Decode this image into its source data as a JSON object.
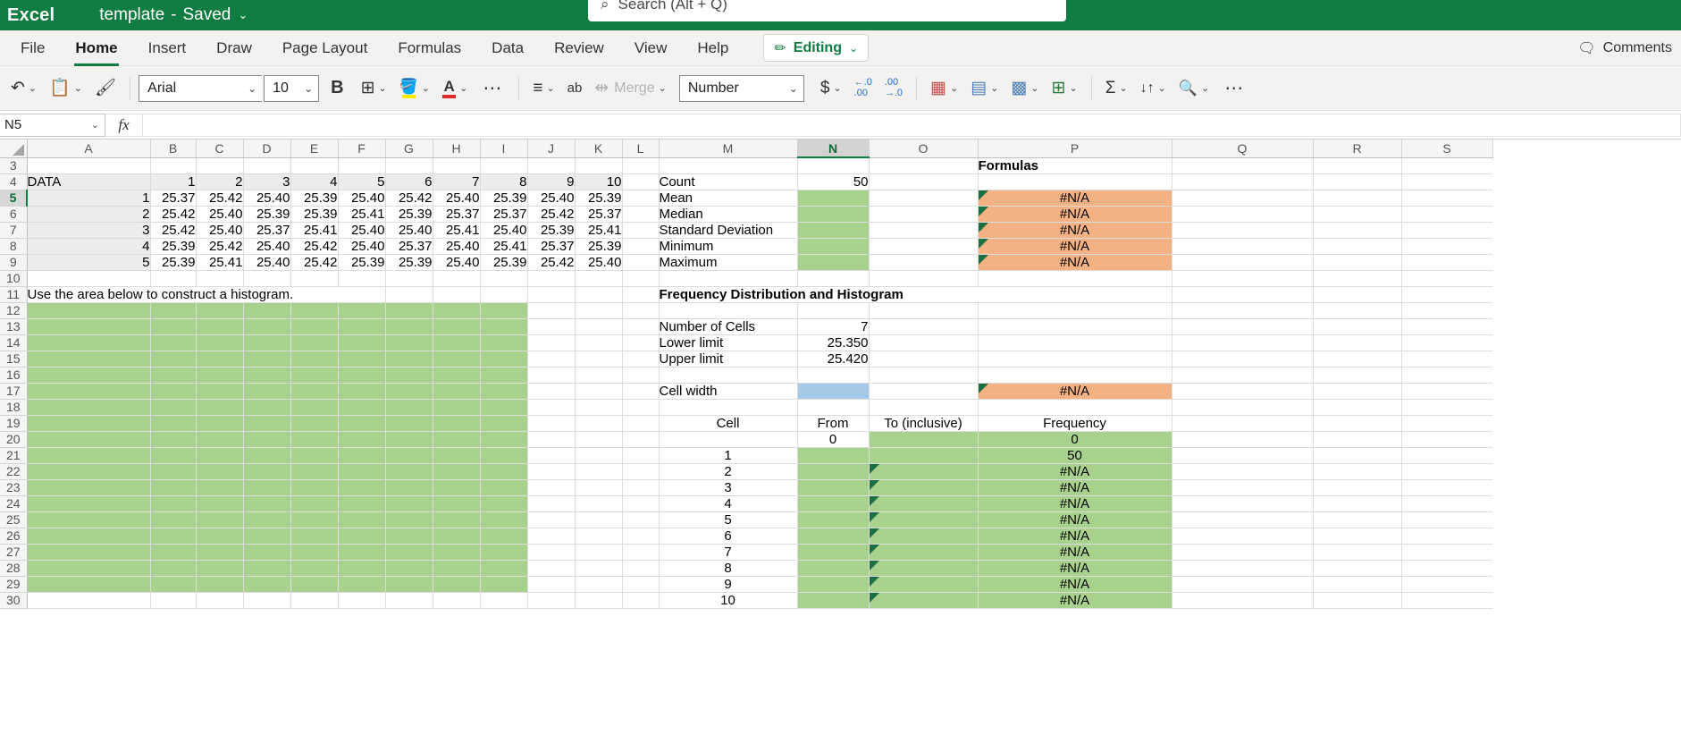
{
  "titlebar": {
    "app_name": "Excel",
    "doc_title": "template",
    "separator": "-",
    "saved_label": "Saved",
    "chevron": "⌄",
    "search_icon": "⌕",
    "search_placeholder": "Search (Alt + Q)"
  },
  "ribbon": {
    "tabs": [
      {
        "label": "File",
        "active": false
      },
      {
        "label": "Home",
        "active": true
      },
      {
        "label": "Insert",
        "active": false
      },
      {
        "label": "Draw",
        "active": false
      },
      {
        "label": "Page Layout",
        "active": false
      },
      {
        "label": "Formulas",
        "active": false
      },
      {
        "label": "Data",
        "active": false
      },
      {
        "label": "Review",
        "active": false
      },
      {
        "label": "View",
        "active": false
      },
      {
        "label": "Help",
        "active": false
      }
    ],
    "editing_button": {
      "pen_icon": "✏",
      "label": "Editing",
      "chevron": "⌄"
    },
    "comments": {
      "icon": "🗨",
      "label": "Comments"
    }
  },
  "toolbar": {
    "undo_icon": "↶",
    "undo_chevron": "⌄",
    "paste_icon": "📋",
    "paste_chevron": "⌄",
    "format_painter_icon": "🖌",
    "font_name": "Arial",
    "font_size": "10",
    "bold_label": "B",
    "borders_icon": "⊞",
    "borders_chevron": "⌄",
    "fill_icon": "🪣",
    "fill_chevron": "⌄",
    "font_color_icon": "A",
    "font_color_chevron": "⌄",
    "more_font_icon": "⋯",
    "align_icon": "≡",
    "align_chevron": "⌄",
    "wrap_icon": "ab",
    "merge_icon": "⇹",
    "merge_label": "Merge",
    "merge_chevron": "⌄",
    "number_format": "Number",
    "currency_icon": "$",
    "currency_chevron": "⌄",
    "decrease_decimal_top": "←.0",
    "decrease_decimal_bottom": ".00",
    "increase_decimal_top": ".00",
    "increase_decimal_bottom": "→.0",
    "cond_format_icon": "▦",
    "cond_format_chevron": "⌄",
    "format_table_icon": "▤",
    "format_table_chevron": "⌄",
    "cell_styles_icon": "▩",
    "cell_styles_chevron": "⌄",
    "insert_cells_icon": "⊞",
    "insert_cells_chevron": "⌄",
    "autosum_icon": "Σ",
    "autosum_chevron": "⌄",
    "sort_icon": "↓↑",
    "sort_chevron": "⌄",
    "find_icon": "🔍",
    "find_chevron": "⌄",
    "overflow_icon": "⋯"
  },
  "formula_bar": {
    "name_box_value": "N5",
    "name_box_chevron": "⌄",
    "fx_label": "fx",
    "formula_value": ""
  },
  "grid": {
    "columns": [
      "A",
      "B",
      "C",
      "D",
      "E",
      "F",
      "G",
      "H",
      "I",
      "J",
      "K",
      "L",
      "M",
      "N",
      "O",
      "P",
      "Q",
      "R",
      "S"
    ],
    "selected_column": "N",
    "selected_row": "5",
    "selected_cell": "N5",
    "rows": [
      "3",
      "4",
      "5",
      "6",
      "7",
      "8",
      "9",
      "10",
      "11",
      "12",
      "13",
      "14",
      "15",
      "16",
      "17",
      "18",
      "19",
      "20",
      "21",
      "22",
      "23",
      "24",
      "25",
      "26",
      "27",
      "28",
      "29",
      "30"
    ],
    "data_label": "DATA",
    "data_col_headers": [
      "1",
      "2",
      "3",
      "4",
      "5",
      "6",
      "7",
      "8",
      "9",
      "10"
    ],
    "data_row_labels": [
      "1",
      "2",
      "3",
      "4",
      "5"
    ],
    "data_values": [
      [
        "25.37",
        "25.42",
        "25.40",
        "25.39",
        "25.40",
        "25.42",
        "25.40",
        "25.39",
        "25.40",
        "25.39"
      ],
      [
        "25.42",
        "25.40",
        "25.39",
        "25.39",
        "25.41",
        "25.39",
        "25.37",
        "25.37",
        "25.42",
        "25.37"
      ],
      [
        "25.42",
        "25.40",
        "25.37",
        "25.41",
        "25.40",
        "25.40",
        "25.41",
        "25.40",
        "25.39",
        "25.41"
      ],
      [
        "25.39",
        "25.42",
        "25.40",
        "25.42",
        "25.40",
        "25.37",
        "25.40",
        "25.41",
        "25.37",
        "25.39"
      ],
      [
        "25.39",
        "25.41",
        "25.40",
        "25.42",
        "25.39",
        "25.39",
        "25.40",
        "25.39",
        "25.42",
        "25.40"
      ]
    ],
    "histogram_note": "Use the area below to construct a histogram.",
    "formulas_header": "Formulas",
    "stats": [
      {
        "label": "Count",
        "value": "50",
        "formula": "",
        "value_fill": "none",
        "formula_fill": "none",
        "formula_error": false
      },
      {
        "label": "Mean",
        "value": "",
        "formula": "#N/A",
        "value_fill": "green",
        "formula_fill": "orange",
        "formula_error": true
      },
      {
        "label": "Median",
        "value": "",
        "formula": "#N/A",
        "value_fill": "green",
        "formula_fill": "orange",
        "formula_error": true
      },
      {
        "label": "Standard Deviation",
        "value": "",
        "formula": "#N/A",
        "value_fill": "green",
        "formula_fill": "orange",
        "formula_error": true
      },
      {
        "label": "Minimum",
        "value": "",
        "formula": "#N/A",
        "value_fill": "green",
        "formula_fill": "orange",
        "formula_error": true
      },
      {
        "label": "Maximum",
        "value": "",
        "formula": "#N/A",
        "value_fill": "green",
        "formula_fill": "orange",
        "formula_error": true
      }
    ],
    "freq_section_title": "Frequency Distribution and Histogram",
    "params": [
      {
        "label": "Number of Cells",
        "value": "7"
      },
      {
        "label": "Lower limit",
        "value": "25.350"
      },
      {
        "label": "Upper limit",
        "value": "25.420"
      }
    ],
    "cell_width": {
      "label": "Cell width",
      "value": "",
      "formula": "#N/A"
    },
    "freq_headers": {
      "cell": "Cell",
      "from": "From",
      "to": "To (inclusive)",
      "frequency": "Frequency"
    },
    "freq_rows": [
      {
        "cell": "",
        "from": "0",
        "to": "",
        "frequency": "0",
        "freq_error": false
      },
      {
        "cell": "1",
        "from": "",
        "to": "",
        "frequency": "50",
        "freq_error": false
      },
      {
        "cell": "2",
        "from": "",
        "to": "",
        "frequency": "#N/A",
        "freq_error": true
      },
      {
        "cell": "3",
        "from": "",
        "to": "",
        "frequency": "#N/A",
        "freq_error": true
      },
      {
        "cell": "4",
        "from": "",
        "to": "",
        "frequency": "#N/A",
        "freq_error": true
      },
      {
        "cell": "5",
        "from": "",
        "to": "",
        "frequency": "#N/A",
        "freq_error": true
      },
      {
        "cell": "6",
        "from": "",
        "to": "",
        "frequency": "#N/A",
        "freq_error": true
      },
      {
        "cell": "7",
        "from": "",
        "to": "",
        "frequency": "#N/A",
        "freq_error": true
      },
      {
        "cell": "8",
        "from": "",
        "to": "",
        "frequency": "#N/A",
        "freq_error": true
      },
      {
        "cell": "9",
        "from": "",
        "to": "",
        "frequency": "#N/A",
        "freq_error": true
      },
      {
        "cell": "10",
        "from": "",
        "to": "",
        "frequency": "#N/A",
        "freq_error": true
      }
    ]
  },
  "colors": {
    "brand_green": "#107C41",
    "fill_green": "#A9D18E",
    "fill_blue": "#A6C9E8",
    "fill_orange": "#F4B183",
    "error_flag": "#1D6F42"
  }
}
